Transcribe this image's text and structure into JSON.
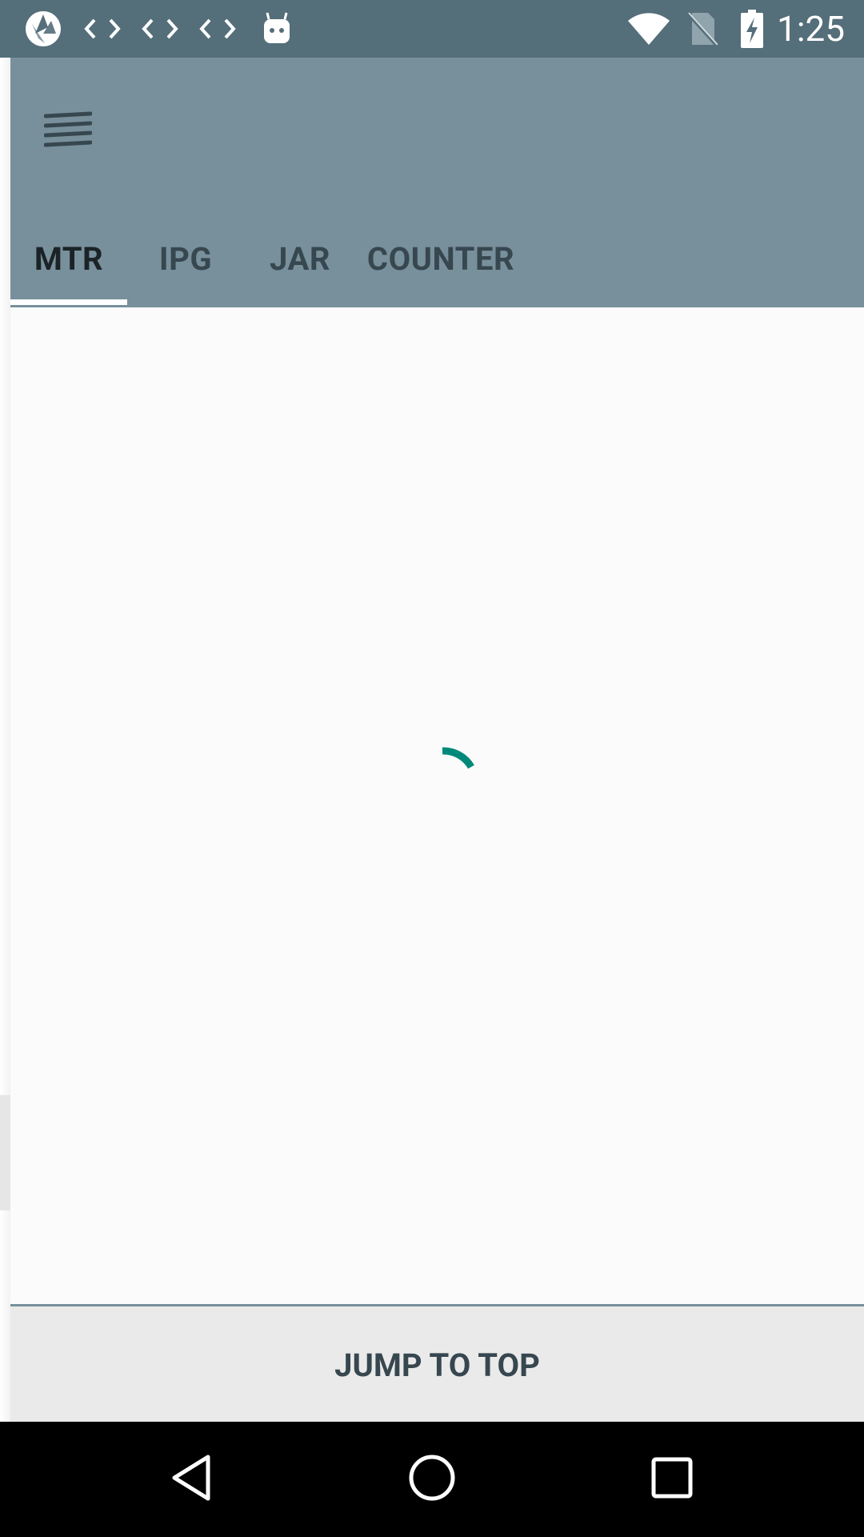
{
  "status_bar": {
    "time": "1:25",
    "left_icons": [
      "aperture-icon",
      "code-icon",
      "code-icon",
      "code-icon",
      "android-icon"
    ],
    "right_icons": [
      "wifi-icon",
      "no-sim-icon",
      "battery-charging-icon"
    ]
  },
  "app_bar": {
    "menu_icon": "hamburger-menu-icon",
    "tabs": [
      {
        "label": "MTR",
        "selected": true
      },
      {
        "label": "IPG",
        "selected": false
      },
      {
        "label": "JAR",
        "selected": false
      },
      {
        "label": "COUNTER",
        "selected": false
      }
    ]
  },
  "content": {
    "loading": true,
    "spinner_color": "#00897b"
  },
  "footer": {
    "jump_label": "JUMP TO TOP"
  },
  "nav_bar": {
    "icons": [
      "back-icon",
      "home-icon",
      "recents-icon"
    ]
  },
  "colors": {
    "status_bar": "#546e7a",
    "app_bar": "#78909c",
    "tab_indicator": "#ffffff",
    "footer_bg": "#eaeaea"
  }
}
